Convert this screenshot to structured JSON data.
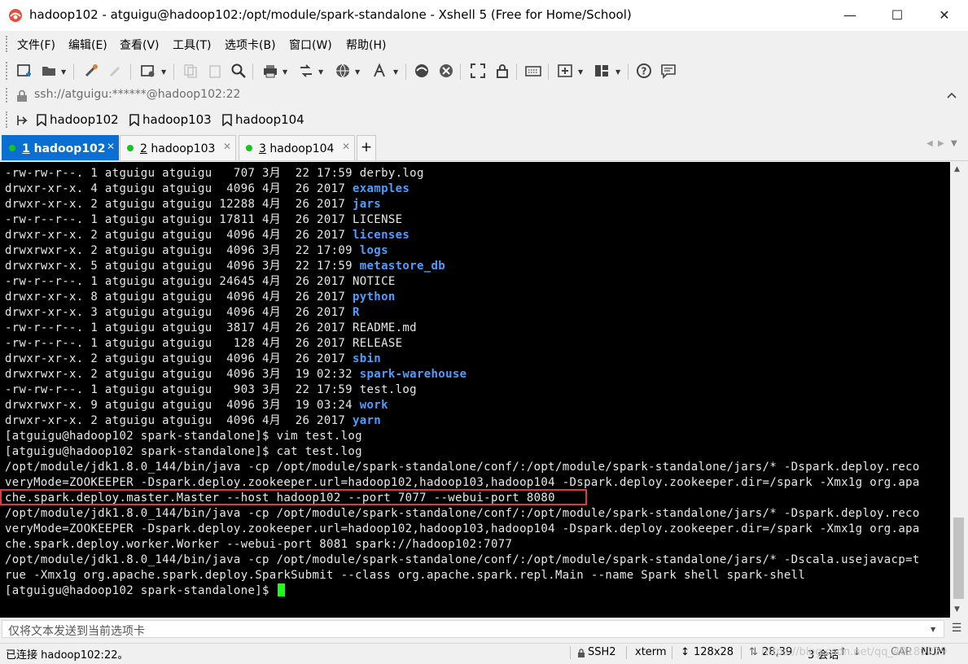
{
  "window": {
    "title": "hadoop102 - atguigu@hadoop102:/opt/module/spark-standalone - Xshell 5 (Free for Home/School)",
    "minimize_icon": "minimize-icon",
    "maximize_icon": "maximize-icon",
    "close_icon": "close-icon"
  },
  "menu": [
    {
      "label": "文件(F)"
    },
    {
      "label": "编辑(E)"
    },
    {
      "label": "查看(V)"
    },
    {
      "label": "工具(T)"
    },
    {
      "label": "选项卡(B)"
    },
    {
      "label": "窗口(W)"
    },
    {
      "label": "帮助(H)"
    }
  ],
  "address": {
    "text": "ssh://atguigu:******@hadoop102:22"
  },
  "links": [
    {
      "label": "hadoop102"
    },
    {
      "label": "hadoop103"
    },
    {
      "label": "hadoop104"
    }
  ],
  "tabs": [
    {
      "num": "1",
      "label": " hadoop102"
    },
    {
      "num": "2",
      "label": " hadoop103"
    },
    {
      "num": "3",
      "label": " hadoop104"
    }
  ],
  "tab_add": "+",
  "colors": {
    "terminal_bg": "#000000",
    "terminal_fg": "#e8e8e8",
    "directory": "#4f9dff",
    "cursor": "#1aff1a",
    "active_tab": "#0b6fd2",
    "connected_dot": "#19c31d",
    "highlight_box": "#e53935"
  },
  "terminal": {
    "lines": [
      {
        "pre": "-rw-rw-r--. 1 atguigu atguigu   707 3月  22 17:59 ",
        "name": "derby.log"
      },
      {
        "pre": "drwxr-xr-x. 4 atguigu atguigu  4096 4月  26 2017 ",
        "dir": "examples"
      },
      {
        "pre": "drwxr-xr-x. 2 atguigu atguigu 12288 4月  26 2017 ",
        "dir": "jars"
      },
      {
        "pre": "-rw-r--r--. 1 atguigu atguigu 17811 4月  26 2017 ",
        "name": "LICENSE"
      },
      {
        "pre": "drwxr-xr-x. 2 atguigu atguigu  4096 4月  26 2017 ",
        "dir": "licenses"
      },
      {
        "pre": "drwxrwxr-x. 2 atguigu atguigu  4096 3月  22 17:09 ",
        "dir": "logs"
      },
      {
        "pre": "drwxrwxr-x. 5 atguigu atguigu  4096 3月  22 17:59 ",
        "dir": "metastore_db"
      },
      {
        "pre": "-rw-r--r--. 1 atguigu atguigu 24645 4月  26 2017 ",
        "name": "NOTICE"
      },
      {
        "pre": "drwxr-xr-x. 8 atguigu atguigu  4096 4月  26 2017 ",
        "dir": "python"
      },
      {
        "pre": "drwxr-xr-x. 3 atguigu atguigu  4096 4月  26 2017 ",
        "dir": "R"
      },
      {
        "pre": "-rw-r--r--. 1 atguigu atguigu  3817 4月  26 2017 ",
        "name": "README.md"
      },
      {
        "pre": "-rw-r--r--. 1 atguigu atguigu   128 4月  26 2017 ",
        "name": "RELEASE"
      },
      {
        "pre": "drwxr-xr-x. 2 atguigu atguigu  4096 4月  26 2017 ",
        "dir": "sbin"
      },
      {
        "pre": "drwxrwxr-x. 2 atguigu atguigu  4096 3月  19 02:32 ",
        "dir": "spark-warehouse"
      },
      {
        "pre": "-rw-rw-r--. 1 atguigu atguigu   903 3月  22 17:59 ",
        "name": "test.log"
      },
      {
        "pre": "drwxrwxr-x. 9 atguigu atguigu  4096 3月  19 03:24 ",
        "dir": "work"
      },
      {
        "pre": "drwxr-xr-x. 2 atguigu atguigu  4096 4月  26 2017 ",
        "dir": "yarn"
      },
      {
        "pre": "[atguigu@hadoop102 spark-standalone]$ vim test.log"
      },
      {
        "pre": "[atguigu@hadoop102 spark-standalone]$ cat test.log"
      },
      {
        "pre": "/opt/module/jdk1.8.0_144/bin/java -cp /opt/module/spark-standalone/conf/:/opt/module/spark-standalone/jars/* -Dspark.deploy.reco"
      },
      {
        "pre": "veryMode=ZOOKEEPER -Dspark.deploy.zookeeper.url=hadoop102,hadoop103,hadoop104 -Dspark.deploy.zookeeper.dir=/spark -Xmx1g org.apa"
      },
      {
        "pre": "che.spark.deploy.master.Master --host hadoop102 --port 7077 --webui-port 8080"
      },
      {
        "pre": "/opt/module/jdk1.8.0_144/bin/java -cp /opt/module/spark-standalone/conf/:/opt/module/spark-standalone/jars/* -Dspark.deploy.reco"
      },
      {
        "pre": "veryMode=ZOOKEEPER -Dspark.deploy.zookeeper.url=hadoop102,hadoop103,hadoop104 -Dspark.deploy.zookeeper.dir=/spark -Xmx1g org.apa"
      },
      {
        "pre": "che.spark.deploy.worker.Worker --webui-port 8081 spark://hadoop102:7077"
      },
      {
        "pre": "/opt/module/jdk1.8.0_144/bin/java -cp /opt/module/spark-standalone/conf/:/opt/module/spark-standalone/jars/* -Dscala.usejavacp=t"
      },
      {
        "pre": "rue -Xmx1g org.apache.spark.deploy.SparkSubmit --class org.apache.spark.repl.Main --name Spark shell spark-shell"
      },
      {
        "pre": "[atguigu@hadoop102 spark-standalone]$ ",
        "cursor": true
      }
    ]
  },
  "send_bar": {
    "placeholder": "仅将文本发送到当前选项卡"
  },
  "status": {
    "connection": "已连接 hadoop102:22。",
    "protocol": "SSH2",
    "term": "xterm",
    "size": "128x28",
    "position": "28,39",
    "sessions": "3 会话",
    "caps": "CAP",
    "num": "NUM",
    "watermark": "https://blog.csdn.net/qq_40180229"
  }
}
